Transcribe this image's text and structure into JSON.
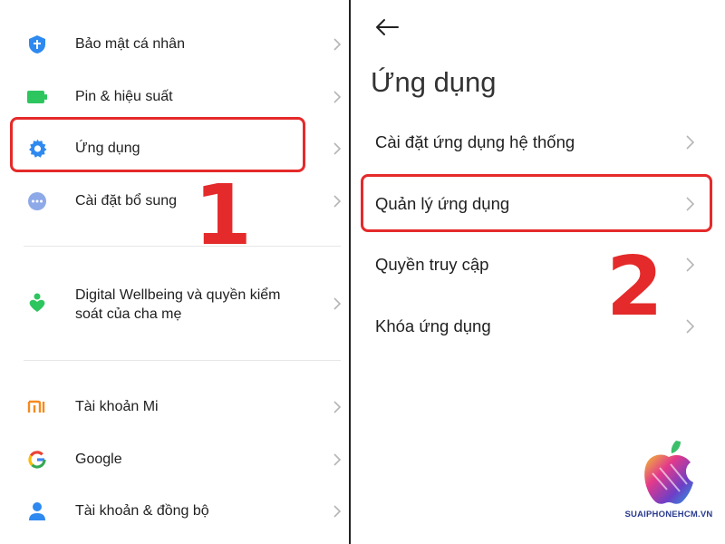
{
  "left_panel": {
    "items": [
      {
        "label": "Bảo mật cá nhân",
        "icon": "shield-icon",
        "color": "#2e89f0"
      },
      {
        "label": "Pin & hiệu suất",
        "icon": "battery-icon",
        "color": "#2dc55e"
      },
      {
        "label": "Ứng dụng",
        "icon": "gear-icon",
        "color": "#2e89f0"
      },
      {
        "label": "Cài đặt bổ sung",
        "icon": "more-icon",
        "color": "#8da9e8"
      }
    ],
    "wellbeing_line1": "Digital Wellbeing và quyền kiểm",
    "wellbeing_line2": "soát của cha mẹ",
    "accounts": [
      {
        "label": "Tài khoản Mi",
        "icon": "mi-logo-icon"
      },
      {
        "label": "Google",
        "icon": "google-logo-icon"
      },
      {
        "label": "Tài khoản & đồng bộ",
        "icon": "user-icon"
      }
    ],
    "step_number": "1"
  },
  "right_panel": {
    "title": "Ứng dụng",
    "items": [
      "Cài đặt ứng dụng hệ thống",
      "Quản lý ứng dụng",
      "Quyền truy cập",
      "Khóa ứng dụng"
    ],
    "step_number": "2"
  },
  "watermark": {
    "text": "SUAIPHONEHCM.VN"
  },
  "colors": {
    "highlight": "#e52a2a",
    "accent": "#2e89f0",
    "green": "#2dc55e"
  }
}
